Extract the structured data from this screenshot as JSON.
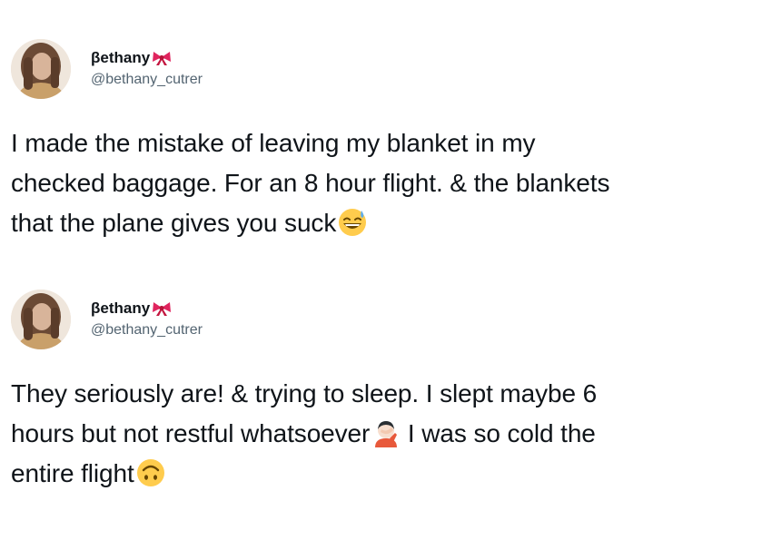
{
  "tweets": [
    {
      "display_name": "βethany",
      "name_icon": "red-bow-icon",
      "handle": "@bethany_cutrer",
      "lines": [
        "I made the mistake of leaving my blanket in my",
        "checked baggage. For an 8 hour flight. & the blankets",
        "that the plane gives you suck"
      ],
      "end_icon": "grinning-sweat-face-icon"
    },
    {
      "display_name": "βethany",
      "name_icon": "red-bow-icon",
      "handle": "@bethany_cutrer",
      "line1": "They seriously are! & trying to sleep. I slept maybe 6",
      "line2_before": "hours but not restful whatsoever",
      "line2_after": " I was so cold the",
      "line3": "entire flight",
      "mid_icon": "person-facepalming-icon",
      "end_icon": "upside-down-face-icon"
    }
  ],
  "colors": {
    "text": "#0f1419",
    "handle": "#536471",
    "bow": "#e0245e",
    "emoji_yellow": "#ffcc4d"
  }
}
